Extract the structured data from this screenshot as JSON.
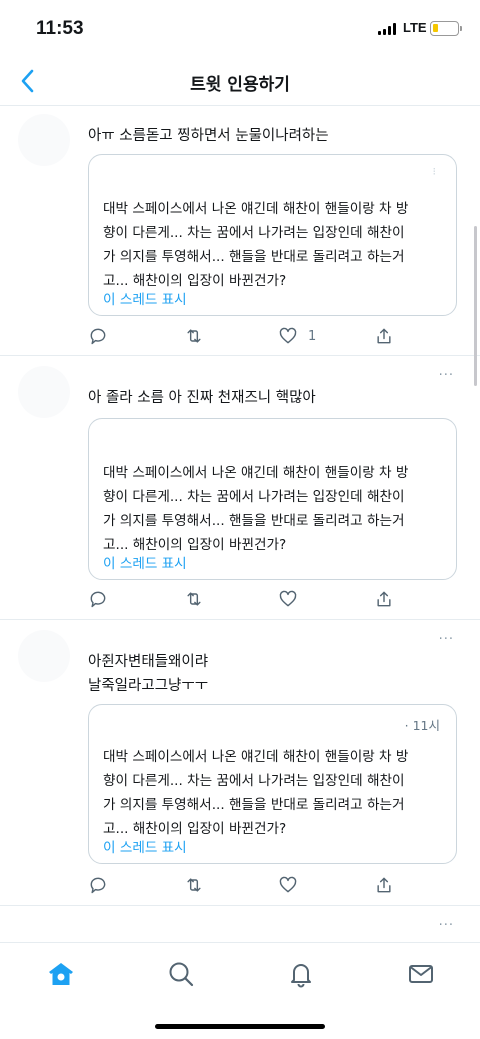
{
  "status_bar": {
    "time": "11:53",
    "network": "LTE",
    "battery_level": 0.2,
    "battery_color": "#f5c700"
  },
  "header": {
    "title": "트윗 인용하기",
    "back_icon": "chevron-left-icon"
  },
  "tweets": [
    {
      "text_lines": [
        "아ㅠ 소름돋고 찡하면서 눈물이나려하는"
      ],
      "quote": {
        "time": "",
        "text_lines": [
          "대박 스페이스에서 나온 얘긴데 해찬이 핸들이랑 차 방",
          "향이 다른게... 차는 꿈에서 나가려는 입장인데 해찬이",
          "가 의지를 투영해서... 핸들을 반대로 돌리려고 하는거",
          "고... 해찬이의 입장이 바뀐건가?"
        ],
        "link": "이 스레드 표시"
      },
      "like_count": "1"
    },
    {
      "text_lines": [
        "아 졸라 소름 아 진짜 천재즈니 핵많아"
      ],
      "quote": {
        "time": "",
        "text_lines": [
          "대박 스페이스에서 나온 얘긴데 해찬이 핸들이랑 차 방",
          "향이 다른게... 차는 꿈에서 나가려는 입장인데 해찬이",
          "가 의지를 투영해서... 핸들을 반대로 돌리려고 하는거",
          "고... 해찬이의 입장이 바뀐건가?"
        ],
        "link": "이 스레드 표시"
      },
      "like_count": ""
    },
    {
      "text_lines": [
        "아쥔자변태들왜이랴",
        "날죽일라고그냥ㅜㅜ"
      ],
      "quote": {
        "time": "· 11시",
        "text_lines": [
          "대박 스페이스에서 나온 얘긴데 해찬이 핸들이랑 차 방",
          "향이 다른게... 차는 꿈에서 나가려는 입장인데 해찬이",
          "가 의지를 투영해서... 핸들을 반대로 돌리려고 하는거",
          "고... 해찬이의 입장이 바뀐건가?"
        ],
        "link": "이 스레드 표시"
      },
      "like_count": ""
    }
  ],
  "more_label": "···",
  "bottom_nav": {
    "items": [
      "home-icon",
      "search-icon",
      "notifications-bell-icon",
      "messages-envelope-icon"
    ],
    "active": "home-icon",
    "accent_color": "#1da1f2"
  }
}
